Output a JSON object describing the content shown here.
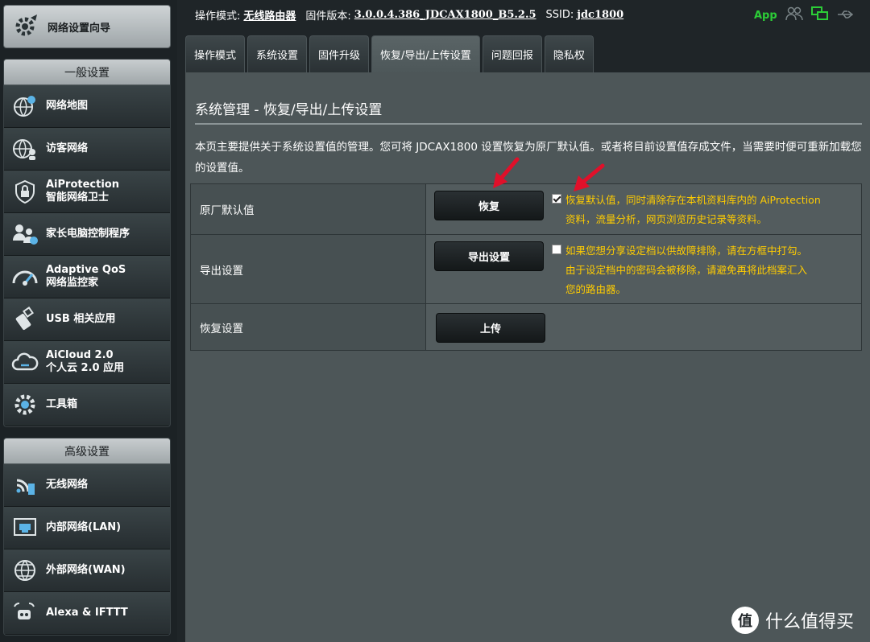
{
  "sidebar": {
    "wizard": {
      "label": "网络设置向导",
      "icon": "wizard-gear-icon"
    },
    "general": {
      "header": "一般设置",
      "items": [
        {
          "line1": "网络地图",
          "line2": "",
          "icon": "globe-map-icon"
        },
        {
          "line1": "访客网络",
          "line2": "",
          "icon": "guest-network-icon"
        },
        {
          "line1": "AiProtection",
          "line2": "智能网络卫士",
          "icon": "shield-lock-icon"
        },
        {
          "line1": "家长电脑控制程序",
          "line2": "",
          "icon": "parental-control-icon"
        },
        {
          "line1": "Adaptive QoS",
          "line2": "网络监控家",
          "icon": "speedometer-icon"
        },
        {
          "line1": "USB 相关应用",
          "line2": "",
          "icon": "usb-icon"
        },
        {
          "line1": "AiCloud 2.0",
          "line2": "个人云 2.0 应用",
          "icon": "cloud-icon"
        },
        {
          "line1": "工具箱",
          "line2": "",
          "icon": "toolbox-gear-icon"
        }
      ]
    },
    "advanced": {
      "header": "高级设置",
      "items": [
        {
          "line1": "无线网络",
          "line2": "",
          "icon": "wireless-icon"
        },
        {
          "line1": "内部网络(LAN)",
          "line2": "",
          "icon": "lan-port-icon"
        },
        {
          "line1": "外部网络(WAN)",
          "line2": "",
          "icon": "wan-globe-icon"
        },
        {
          "line1": "Alexa & IFTTT",
          "line2": "",
          "icon": "alexa-icon"
        }
      ]
    }
  },
  "topbar": {
    "mode_label": "操作模式:",
    "mode_value": "无线路由器",
    "firmware_label": "固件版本:",
    "firmware_value": "3.0.0.4.386_JDCAX1800_B5.2.5",
    "ssid_label": "SSID:",
    "ssid_value": "jdc1800",
    "app_label": "App"
  },
  "tabs": [
    {
      "label": "操作模式",
      "active": false
    },
    {
      "label": "系统设置",
      "active": false
    },
    {
      "label": "固件升级",
      "active": false
    },
    {
      "label": "恢复/导出/上传设置",
      "active": true
    },
    {
      "label": "问题回报",
      "active": false
    },
    {
      "label": "隐私权",
      "active": false
    }
  ],
  "main": {
    "title": "系统管理 - 恢复/导出/上传设置",
    "description": "本页主要提供关于系统设置值的管理。您可将 JDCAX1800 设置恢复为原厂默认值。或者将目前设置值存成文件，当需要时便可重新加载您的设置值。",
    "rows": [
      {
        "label": "原厂默认值",
        "button": "恢复",
        "checked": true,
        "note": "恢复默认值，同时清除存在本机资料库内的 AiProtection 资料，流量分析，网页浏览历史记录等资料。"
      },
      {
        "label": "导出设置",
        "button": "导出设置",
        "checked": false,
        "note": "如果您想分享设定档以供故障排除，请在方框中打勾。由于设定档中的密码会被移除，请避免再将此档案汇入您的路由器。"
      },
      {
        "label": "恢复设置",
        "button": "上传",
        "checked": null,
        "note": ""
      }
    ]
  },
  "watermark": {
    "text": "什么值得买",
    "logo": "值"
  },
  "colors": {
    "note": "#ffcc00",
    "app": "#2ccd37",
    "arrow": "#e0102a",
    "panel": "#4d5658"
  }
}
